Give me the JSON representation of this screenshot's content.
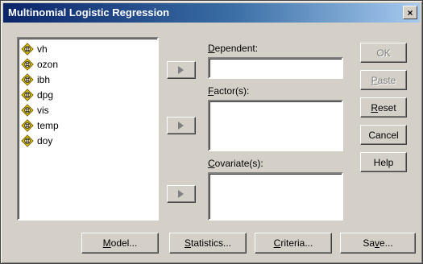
{
  "window": {
    "title": "Multinomial Logistic Regression",
    "close_glyph": "×"
  },
  "variables": [
    {
      "name": "vh",
      "icon": "scale-variable-icon"
    },
    {
      "name": "ozon",
      "icon": "scale-variable-icon"
    },
    {
      "name": "ibh",
      "icon": "scale-variable-icon"
    },
    {
      "name": "dpg",
      "icon": "scale-variable-icon"
    },
    {
      "name": "vis",
      "icon": "scale-variable-icon"
    },
    {
      "name": "temp",
      "icon": "scale-variable-icon"
    },
    {
      "name": "doy",
      "icon": "scale-variable-icon"
    }
  ],
  "fields": {
    "dependent": {
      "mnemonic": "D",
      "rest": "ependent:",
      "value": ""
    },
    "factors": {
      "mnemonic": "F",
      "rest": "actor(s):",
      "value": ""
    },
    "covariates": {
      "mnemonic": "C",
      "rest": "ovariate(s):",
      "value": ""
    }
  },
  "side_buttons": {
    "ok": {
      "label": "OK",
      "enabled": false
    },
    "paste": {
      "mnemonic": "P",
      "rest": "aste",
      "enabled": false
    },
    "reset": {
      "mnemonic": "R",
      "rest": "eset",
      "enabled": true
    },
    "cancel": {
      "label": "Cancel",
      "enabled": true
    },
    "help": {
      "label": "Help",
      "enabled": true
    }
  },
  "bottom_buttons": {
    "model": {
      "mnemonic": "M",
      "rest": "odel..."
    },
    "statistics": {
      "mnemonic": "S",
      "rest": "tatistics..."
    },
    "criteria": {
      "mnemonic": "C",
      "rest": "riteria..."
    },
    "save": {
      "pre": "Sa",
      "mnemonic": "v",
      "rest": "e..."
    }
  },
  "colors": {
    "title_bar_start": "#0a246a",
    "title_bar_end": "#a6caf0",
    "dialog_face": "#d4d0c8",
    "variable_icon": "#e8c800"
  }
}
